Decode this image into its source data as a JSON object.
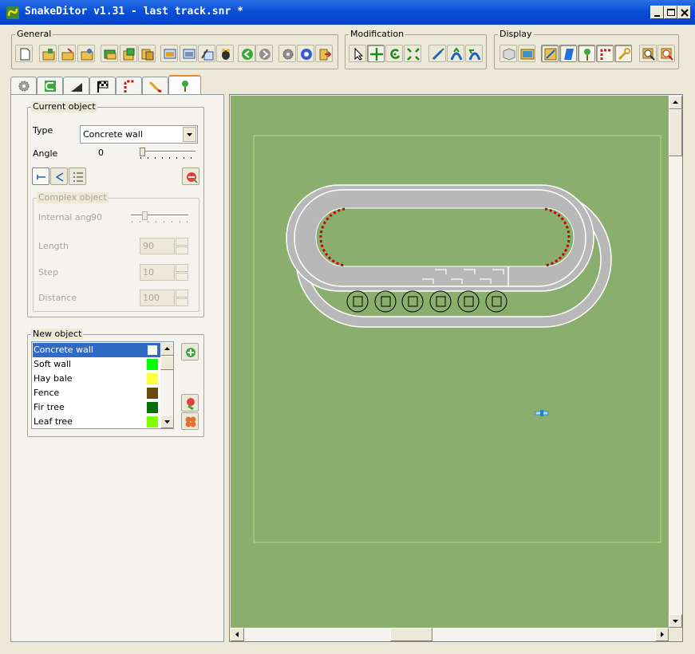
{
  "window": {
    "title": "SnakeDitor v1.31 - last track.snr *",
    "controls": [
      "minimize",
      "maximize",
      "close"
    ]
  },
  "toolbar": {
    "groups": [
      {
        "label": "General",
        "buttons": [
          "new-icon",
          "open-icon",
          "open-folder-icon",
          "save-icon",
          "layer-icon",
          "paste-icon",
          "copy-icon",
          "screen-icon",
          "screen-copy-icon",
          "bug-icon",
          "tools-icon",
          "back-icon",
          "forward-icon",
          "settings-icon",
          "help-icon",
          "exit-icon"
        ]
      },
      {
        "label": "Modification",
        "buttons": [
          "pointer-icon",
          "move-icon",
          "rotate-icon",
          "resize-icon",
          "wand-icon",
          "arch-icon",
          "ramp-icon"
        ]
      },
      {
        "label": "Display",
        "buttons": [
          "3d-box-icon",
          "picture-icon",
          "grid-view-icon",
          "shape-icon",
          "pin-icon",
          "corner-icon",
          "wrench-icon",
          "zoom-in-icon",
          "zoom-out-icon"
        ]
      }
    ],
    "active_buttons": [
      "move-icon",
      "grid-view-icon",
      "shape-icon",
      "pin-icon",
      "corner-icon",
      "wrench-icon"
    ]
  },
  "tabs": [
    {
      "name": "gear-tab",
      "icon": "gear-icon"
    },
    {
      "name": "track-tab",
      "icon": "track-icon"
    },
    {
      "name": "ramp-tab",
      "icon": "ramp-icon"
    },
    {
      "name": "flag-tab",
      "icon": "checkered-flag-icon"
    },
    {
      "name": "curb-tab",
      "icon": "curb-icon"
    },
    {
      "name": "brush-tab",
      "icon": "brush-icon"
    },
    {
      "name": "object-tab",
      "icon": "tree-pin-icon"
    }
  ],
  "active_tab": "object-tab",
  "current_object": {
    "group_label": "Current object",
    "type_label": "Type",
    "type_value": "Concrete wall",
    "angle_label": "Angle",
    "angle_value": "0"
  },
  "complex_object": {
    "group_label": "Complex object",
    "internal_ang_label": "Internal ang.",
    "internal_ang_value": "90",
    "length_label": "Length",
    "length_value": "90",
    "step_label": "Step",
    "step_value": "10",
    "distance_label": "Distance",
    "distance_value": "100"
  },
  "new_object": {
    "group_label": "New object",
    "items": [
      {
        "label": "Concrete wall",
        "color": "#ffffff",
        "selected": true
      },
      {
        "label": "Soft wall",
        "color": "#00ff00",
        "selected": false
      },
      {
        "label": "Hay bale",
        "color": "#ffff40",
        "selected": false
      },
      {
        "label": "Fence",
        "color": "#6b4a10",
        "selected": false
      },
      {
        "label": "Fir tree",
        "color": "#007000",
        "selected": false
      },
      {
        "label": "Leaf tree",
        "color": "#80ff00",
        "selected": false
      }
    ]
  },
  "colors": {
    "canvas_bg": "#8aae6e",
    "track_asphalt": "#b8b8b8",
    "track_edge": "#ffffff",
    "curb_red": "#cc0000",
    "titlebar": "#0a4fd8"
  }
}
